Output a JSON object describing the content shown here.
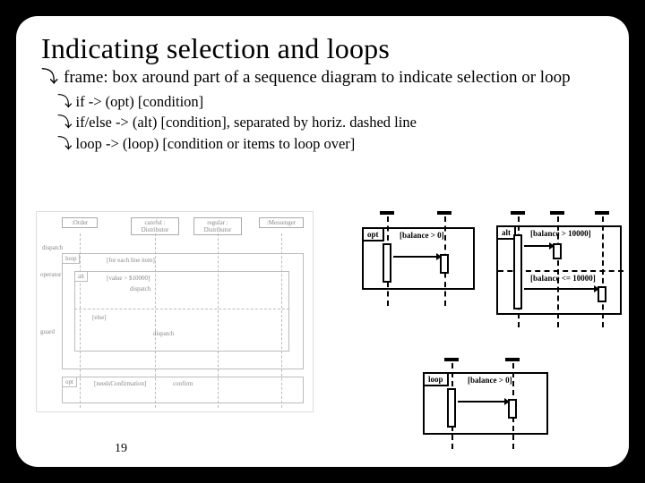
{
  "title": "Indicating selection and loops",
  "bullet_glyph": "⤵",
  "main_bullet": "frame: box around part of a sequence diagram to indicate selection or loop",
  "subs": {
    "s1": "if -> (opt) [condition]",
    "s2": "if/else -> (alt) [condition], separated by horiz. dashed line",
    "s3": "loop -> (loop) [condition or items to loop over]"
  },
  "left_uml": {
    "obj1": ":Order",
    "obj2": "careful : Distributor",
    "obj3": "regular : Distributor",
    "obj4": ":Messenger",
    "msg_dispatch": "dispatch",
    "tag_loop": "loop",
    "cond_loop": "[for each line item]",
    "tag_alt": "alt",
    "cond_alt": "[value > $10000]",
    "cond_else": "[else]",
    "tag_opt": "opt",
    "cond_opt": "[needsConfirmation]",
    "msg_confirm": "confirm",
    "label_operator": "operator",
    "label_guard": "guard"
  },
  "mini_opt": {
    "tag": "opt",
    "cond": "[balance > 0]"
  },
  "mini_alt": {
    "tag": "alt",
    "cond1": "[balance > 10000]",
    "cond2": "[balance <= 10000]"
  },
  "mini_loop": {
    "tag": "loop",
    "cond": "[balance > 0]"
  },
  "page_number": "19"
}
